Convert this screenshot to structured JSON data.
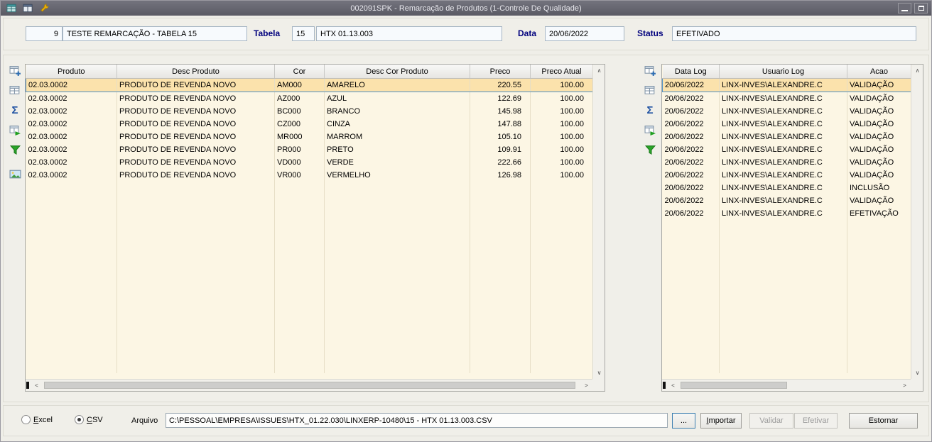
{
  "window": {
    "title": "002091SPK - Remarcação de Produtos (1-Controle De Qualidade)"
  },
  "header": {
    "id_value": "9",
    "name_value": "TESTE REMARCAÇÃO - TABELA 15",
    "tabela_label": "Tabela",
    "tabela_value": "15",
    "tabela_desc": "HTX 01.13.003",
    "data_label": "Data",
    "data_value": "20/06/2022",
    "status_label": "Status",
    "status_value": "EFETIVADO"
  },
  "icons": {
    "sigma": "Σ"
  },
  "left_grid": {
    "selected_row": 0,
    "columns": [
      "Produto",
      "Desc Produto",
      "Cor",
      "Desc Cor Produto",
      "Preco",
      "Preco Atual"
    ],
    "rows": [
      [
        "02.03.0002",
        "PRODUTO DE REVENDA NOVO",
        "AM000",
        "AMARELO",
        "220.55",
        "100.00"
      ],
      [
        "02.03.0002",
        "PRODUTO DE REVENDA NOVO",
        "AZ000",
        "AZUL",
        "122.69",
        "100.00"
      ],
      [
        "02.03.0002",
        "PRODUTO DE REVENDA NOVO",
        "BC000",
        "BRANCO",
        "145.98",
        "100.00"
      ],
      [
        "02.03.0002",
        "PRODUTO DE REVENDA NOVO",
        "CZ000",
        "CINZA",
        "147.88",
        "100.00"
      ],
      [
        "02.03.0002",
        "PRODUTO DE REVENDA NOVO",
        "MR000",
        "MARROM",
        "105.10",
        "100.00"
      ],
      [
        "02.03.0002",
        "PRODUTO DE REVENDA NOVO",
        "PR000",
        "PRETO",
        "109.91",
        "100.00"
      ],
      [
        "02.03.0002",
        "PRODUTO DE REVENDA NOVO",
        "VD000",
        "VERDE",
        "222.66",
        "100.00"
      ],
      [
        "02.03.0002",
        "PRODUTO DE REVENDA NOVO",
        "VR000",
        "VERMELHO",
        "126.98",
        "100.00"
      ]
    ]
  },
  "right_grid": {
    "selected_row": 0,
    "columns": [
      "Data Log",
      "Usuario Log",
      "Acao"
    ],
    "rows": [
      [
        "20/06/2022",
        "LINX-INVES\\ALEXANDRE.C",
        "VALIDAÇÃO"
      ],
      [
        "20/06/2022",
        "LINX-INVES\\ALEXANDRE.C",
        "VALIDAÇÃO"
      ],
      [
        "20/06/2022",
        "LINX-INVES\\ALEXANDRE.C",
        "VALIDAÇÃO"
      ],
      [
        "20/06/2022",
        "LINX-INVES\\ALEXANDRE.C",
        "VALIDAÇÃO"
      ],
      [
        "20/06/2022",
        "LINX-INVES\\ALEXANDRE.C",
        "VALIDAÇÃO"
      ],
      [
        "20/06/2022",
        "LINX-INVES\\ALEXANDRE.C",
        "VALIDAÇÃO"
      ],
      [
        "20/06/2022",
        "LINX-INVES\\ALEXANDRE.C",
        "VALIDAÇÃO"
      ],
      [
        "20/06/2022",
        "LINX-INVES\\ALEXANDRE.C",
        "VALIDAÇÃO"
      ],
      [
        "20/06/2022",
        "LINX-INVES\\ALEXANDRE.C",
        "INCLUSÃO"
      ],
      [
        "20/06/2022",
        "LINX-INVES\\ALEXANDRE.C",
        "VALIDAÇÃO"
      ],
      [
        "20/06/2022",
        "LINX-INVES\\ALEXANDRE.C",
        "EFETIVAÇÃO"
      ]
    ]
  },
  "footer": {
    "excel_label": "Excel",
    "csv_label": "CSV",
    "arquivo_label": "Arquivo",
    "arquivo_value": "C:\\PESSOAL\\EMPRESA\\ISSUES\\HTX_01.22.030\\LINXERP-10480\\15 - HTX 01.13.003.CSV",
    "browse_label": "...",
    "importar_label": "Importar",
    "validar_label": "Validar",
    "efetivar_label": "Efetivar",
    "estornar_label": "Estornar"
  }
}
